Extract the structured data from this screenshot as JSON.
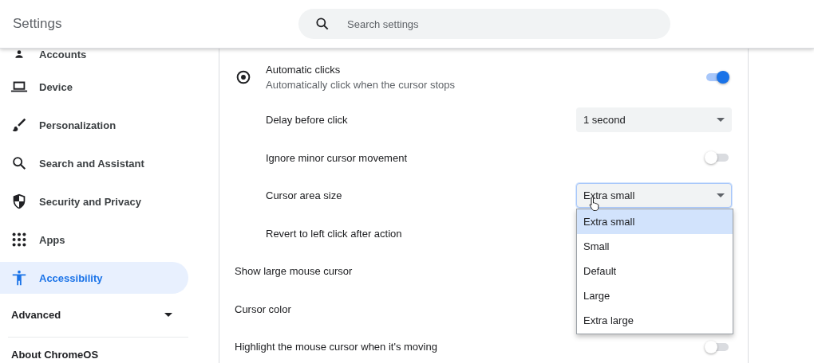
{
  "header": {
    "title": "Settings",
    "search": {
      "placeholder": "Search settings"
    }
  },
  "sidebar": {
    "items": [
      {
        "label": "Accounts",
        "selected": false
      },
      {
        "label": "Device",
        "selected": false
      },
      {
        "label": "Personalization",
        "selected": false
      },
      {
        "label": "Search and Assistant",
        "selected": false
      },
      {
        "label": "Security and Privacy",
        "selected": false
      },
      {
        "label": "Apps",
        "selected": false
      },
      {
        "label": "Accessibility",
        "selected": true
      }
    ],
    "advanced": {
      "label": "Advanced",
      "expanded": false
    },
    "about": "About ChromeOS"
  },
  "rows": [
    {
      "kind": "toggle",
      "label": "Automatic clicks",
      "sublabel": "Automatically click when the cursor stops",
      "nested": false,
      "on": true
    },
    {
      "kind": "select",
      "label": "Delay before click",
      "nested": true,
      "value": "1 second",
      "focused": false
    },
    {
      "kind": "toggle",
      "label": "Ignore minor cursor movement",
      "nested": true,
      "on": false
    },
    {
      "kind": "select",
      "label": "Cursor area size",
      "nested": true,
      "value": "Extra small",
      "focused": true,
      "menu": [
        {
          "label": "Extra small",
          "selected": true
        },
        {
          "label": "Small",
          "selected": false
        },
        {
          "label": "Default",
          "selected": false
        },
        {
          "label": "Large",
          "selected": false
        },
        {
          "label": "Extra large",
          "selected": false
        }
      ]
    },
    {
      "kind": "plain",
      "label": "Revert to left click after action",
      "nested": true
    },
    {
      "kind": "plain",
      "label": "Show large mouse cursor",
      "nested": false
    },
    {
      "kind": "plain",
      "label": "Cursor color",
      "nested": false
    },
    {
      "kind": "toggle",
      "label": "Highlight the mouse cursor when it's moving",
      "nested": false,
      "on": false
    }
  ]
}
